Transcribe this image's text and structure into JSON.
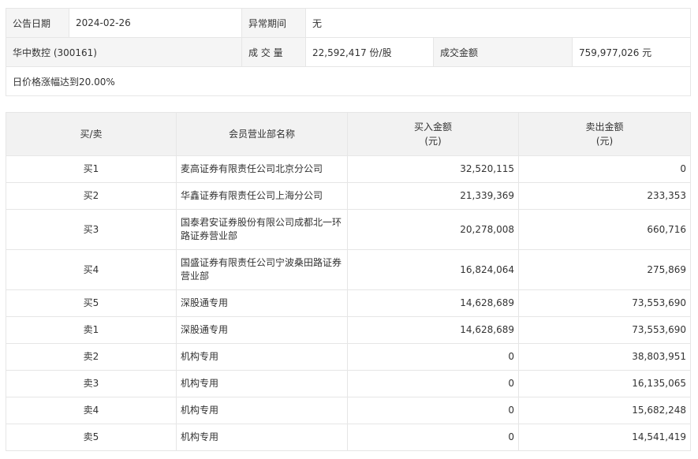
{
  "info": {
    "announce_date_label": "公告日期",
    "announce_date_value": "2024-02-26",
    "abnormal_period_label": "异常期间",
    "abnormal_period_value": "无",
    "stock_name": "华中数控 (300161)",
    "volume_label": "成 交 量",
    "volume_value": "22,592,417 份/股",
    "amount_label": "成交金额",
    "amount_value": "759,977,026 元",
    "reason": "日价格涨幅达到20.00%"
  },
  "table": {
    "headers": {
      "side": "买/卖",
      "branch": "会员营业部名称",
      "buy_amount": "买入金额",
      "buy_unit": "(元)",
      "sell_amount": "卖出金额",
      "sell_unit": "(元)"
    },
    "rows": [
      {
        "side": "买1",
        "branch": "麦高证券有限责任公司北京分公司",
        "buy": "32,520,115",
        "sell": "0"
      },
      {
        "side": "买2",
        "branch": "华鑫证券有限责任公司上海分公司",
        "buy": "21,339,369",
        "sell": "233,353"
      },
      {
        "side": "买3",
        "branch": "国泰君安证券股份有限公司成都北一环路证券营业部",
        "buy": "20,278,008",
        "sell": "660,716"
      },
      {
        "side": "买4",
        "branch": "国盛证券有限责任公司宁波桑田路证券营业部",
        "buy": "16,824,064",
        "sell": "275,869"
      },
      {
        "side": "买5",
        "branch": "深股通专用",
        "buy": "14,628,689",
        "sell": "73,553,690"
      },
      {
        "side": "卖1",
        "branch": "深股通专用",
        "buy": "14,628,689",
        "sell": "73,553,690"
      },
      {
        "side": "卖2",
        "branch": "机构专用",
        "buy": "0",
        "sell": "38,803,951"
      },
      {
        "side": "卖3",
        "branch": "机构专用",
        "buy": "0",
        "sell": "16,135,065"
      },
      {
        "side": "卖4",
        "branch": "机构专用",
        "buy": "0",
        "sell": "15,682,248"
      },
      {
        "side": "卖5",
        "branch": "机构专用",
        "buy": "0",
        "sell": "14,541,419"
      }
    ]
  }
}
